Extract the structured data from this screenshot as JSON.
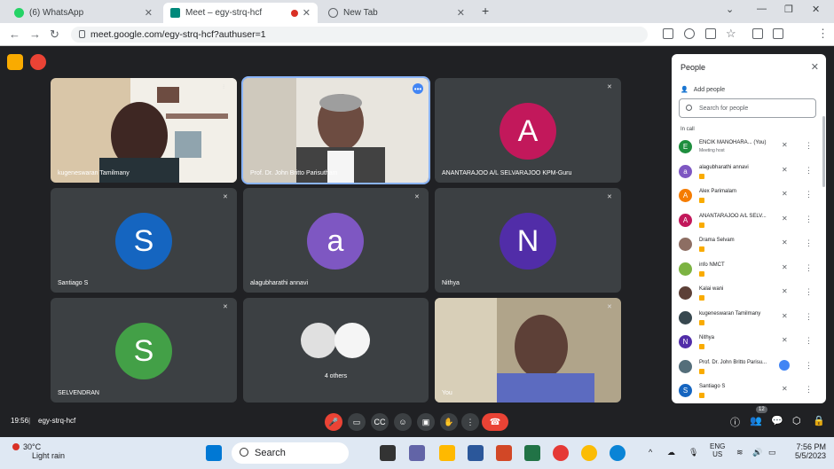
{
  "browser": {
    "tabs": [
      {
        "label": "(6) WhatsApp",
        "active": false
      },
      {
        "label": "Meet – egy-strq-hcf",
        "active": true
      },
      {
        "label": "New Tab",
        "active": false
      }
    ],
    "url": "meet.google.com/egy-strq-hcf?authuser=1"
  },
  "meeting": {
    "time": "19:56",
    "code": "egy-strq-hcf",
    "participant_count": "12",
    "tiles": [
      {
        "name": "kugeneswaran Tamilmany",
        "initial": "",
        "color": ""
      },
      {
        "name": "Prof. Dr. John Britto Parisutham",
        "initial": "",
        "color": ""
      },
      {
        "name": "ANANTARAJOO A/L SELVARAJOO KPM-Guru",
        "initial": "A",
        "color": "#c2185b"
      },
      {
        "name": "Santiago S",
        "initial": "S",
        "color": "#1565c0"
      },
      {
        "name": "alagubharathi annavi",
        "initial": "a",
        "color": "#7e57c2"
      },
      {
        "name": "Nithya",
        "initial": "N",
        "color": "#512da8"
      },
      {
        "name": "SELVENDRAN",
        "initial": "S",
        "color": "#43a047"
      },
      {
        "name": "4 others",
        "initial": "",
        "color": ""
      },
      {
        "name": "You",
        "initial": "",
        "color": ""
      }
    ]
  },
  "panel": {
    "title": "People",
    "add_people": "Add people",
    "search_placeholder": "Search for people",
    "section": "In call",
    "people": [
      {
        "name": "ENCIK MANOHARA...  (You)",
        "sub": "Meeting host",
        "initial": "E",
        "color": "#1e8e3e"
      },
      {
        "name": "alagubharathi annavi",
        "sub": "",
        "initial": "a",
        "color": "#7e57c2"
      },
      {
        "name": "Alex Parimalam",
        "sub": "",
        "initial": "A",
        "color": "#f57c00"
      },
      {
        "name": "ANANTARAJOO A/L SELV...",
        "sub": "",
        "initial": "A",
        "color": "#c2185b"
      },
      {
        "name": "Drama Selvam",
        "sub": "",
        "initial": "",
        "color": "#8d6e63"
      },
      {
        "name": "info NMCT",
        "sub": "",
        "initial": "",
        "color": "#7cb342"
      },
      {
        "name": "Kalai wani",
        "sub": "",
        "initial": "",
        "color": "#5d4037"
      },
      {
        "name": "kugeneswaran Tamilmany",
        "sub": "",
        "initial": "",
        "color": "#37474f"
      },
      {
        "name": "Nithya",
        "sub": "",
        "initial": "N",
        "color": "#512da8"
      },
      {
        "name": "Prof. Dr. John Britto Parisu...",
        "sub": "",
        "initial": "",
        "color": "#546e7a"
      },
      {
        "name": "Santiago S",
        "sub": "",
        "initial": "S",
        "color": "#1565c0"
      }
    ]
  },
  "taskbar": {
    "temp": "30°C",
    "weather": "Light rain",
    "search": "Search",
    "lang1": "ENG",
    "lang2": "US",
    "time": "7:56 PM",
    "date": "5/5/2023"
  }
}
